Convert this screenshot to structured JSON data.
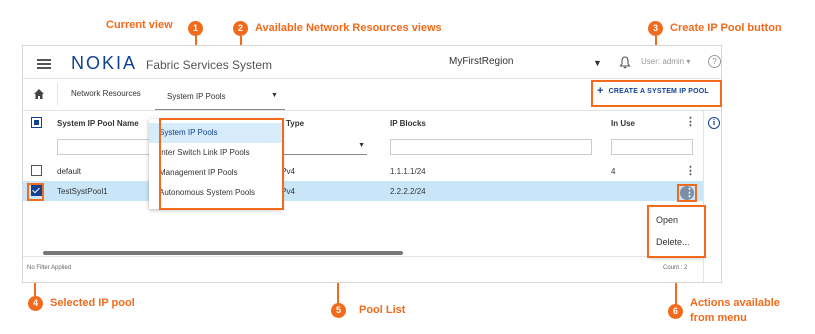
{
  "callouts": {
    "c1": {
      "num": "1",
      "text": "Current view"
    },
    "c2": {
      "num": "2",
      "text": "Available Network Resources views"
    },
    "c3": {
      "num": "3",
      "text": "Create IP Pool button"
    },
    "c4": {
      "num": "4",
      "text": "Selected IP pool"
    },
    "c5": {
      "num": "5",
      "text": "Pool List"
    },
    "c6": {
      "num": "6",
      "text_line1": "Actions available",
      "text_line2": "from menu"
    }
  },
  "app": {
    "logo": "NOKIA",
    "title": "Fabric Services System",
    "region": "MyFirstRegion",
    "user": "User: admin"
  },
  "breadcrumb": {
    "section": "Network Resources",
    "current_view": "System IP Pools"
  },
  "toolbar": {
    "create_label": "CREATE A SYSTEM IP POOL"
  },
  "views_menu": {
    "items": [
      "System IP Pools",
      "Inter Switch Link IP Pools",
      "Management IP Pools",
      "Autonomous System Pools"
    ],
    "selected": "System IP Pools"
  },
  "table": {
    "columns": {
      "name": "System IP Pool Name",
      "type": "Type",
      "ip_blocks": "IP Blocks",
      "in_use": "In Use"
    },
    "rows": [
      {
        "name": "default",
        "type": "IPv4",
        "ip_blocks": "1.1.1.1/24",
        "in_use": "4",
        "selected": false
      },
      {
        "name": "TestSystPool1",
        "type": "IPv4",
        "ip_blocks": "2.2.2.2/24",
        "in_use": "",
        "selected": true
      }
    ],
    "footer_filter": "No Filter Applied",
    "footer_count": "Count : 2"
  },
  "actions_menu": {
    "items": [
      "Open",
      "Delete..."
    ]
  },
  "colors": {
    "accent": "#f26a1b",
    "brand": "#124191",
    "selection": "#c9e6f9"
  }
}
